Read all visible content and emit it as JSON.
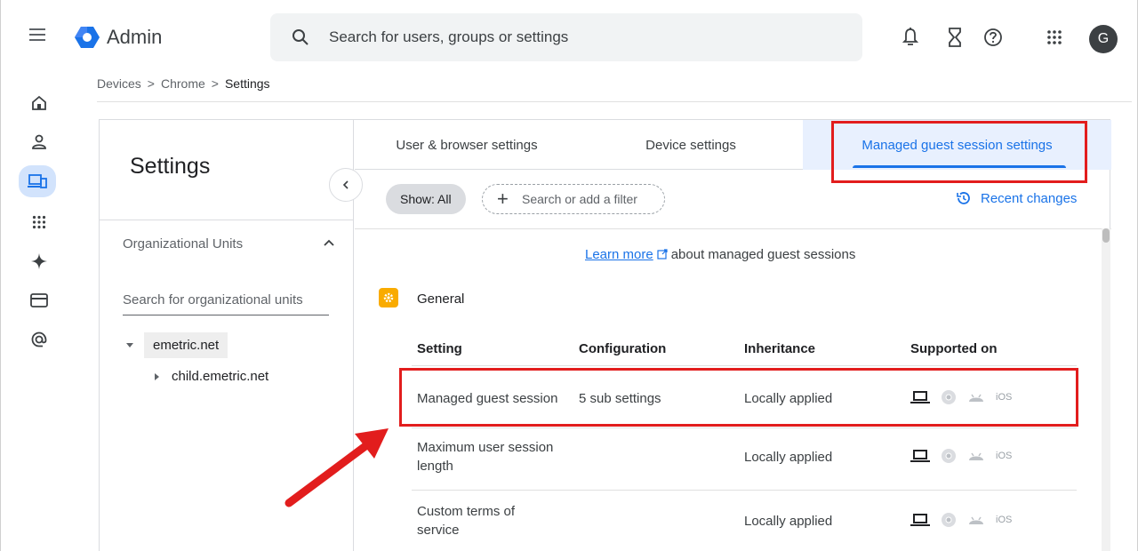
{
  "header": {
    "app_title": "Admin",
    "search_placeholder": "Search for users, groups or settings",
    "avatar_letter": "G",
    "icons": [
      "menu-icon",
      "bell-icon",
      "hourglass-icon",
      "help-icon",
      "apps-grid-icon"
    ]
  },
  "rail": {
    "items": [
      "home-icon",
      "person-icon",
      "devices-icon",
      "apps-icon",
      "sparkle-icon",
      "billing-icon",
      "at-icon"
    ],
    "active": "devices-icon"
  },
  "breadcrumb": {
    "items": [
      "Devices",
      "Chrome"
    ],
    "current": "Settings",
    "separator": ">"
  },
  "left_panel": {
    "title": "Settings",
    "ou_section_title": "Organizational Units",
    "ou_search_placeholder": "Search for organizational units",
    "tree_root": "emetric.net",
    "tree_child": "child.emetric.net"
  },
  "tabs": {
    "items": [
      {
        "label": "User & browser settings"
      },
      {
        "label": "Device settings"
      },
      {
        "label": "Managed guest session settings"
      }
    ],
    "active_index": 2
  },
  "filters": {
    "show_label": "Show: All",
    "filter_placeholder": "Search or add a filter",
    "recent_changes": "Recent changes"
  },
  "content": {
    "learn_more_link": "Learn more",
    "learn_more_rest": "about managed guest sessions",
    "section_title": "General",
    "columns": [
      "Setting",
      "Configuration",
      "Inheritance",
      "Supported on"
    ],
    "rows": [
      {
        "setting": "Managed guest session",
        "configuration": "5 sub settings",
        "inheritance": "Locally applied",
        "platforms": [
          "laptop-icon",
          "chrome-icon",
          "android-icon",
          "iOS"
        ]
      },
      {
        "setting": "Maximum user session length",
        "configuration": "",
        "inheritance": "Locally applied",
        "platforms": [
          "laptop-icon",
          "chrome-icon",
          "android-icon",
          "iOS"
        ]
      },
      {
        "setting": "Custom terms of service",
        "configuration": "",
        "inheritance": "Locally applied",
        "platforms": [
          "laptop-icon",
          "chrome-icon",
          "android-icon",
          "iOS"
        ]
      }
    ]
  },
  "colors": {
    "accent": "#1a73e8",
    "highlight": "#e21d1d",
    "general_icon": "#f9ab00"
  }
}
